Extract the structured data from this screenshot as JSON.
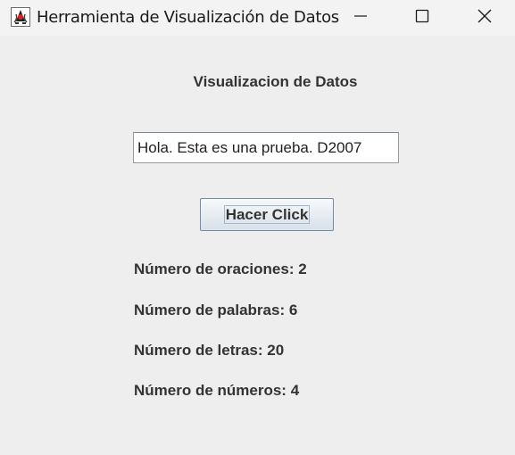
{
  "window": {
    "title": "Herramienta de Visualización de Datos",
    "icon": "java-duke-icon"
  },
  "controls": {
    "minimize": "minimize-icon",
    "maximize": "maximize-icon",
    "close": "close-icon"
  },
  "main": {
    "heading": "Visualizacion de Datos",
    "input_value": "Hola. Esta es una prueba. D2007",
    "button_label": "Hacer Click",
    "stats": [
      "Número de oraciones: 2",
      "Número de palabras: 6",
      "Número de letras: 20",
      "Número de números: 4"
    ]
  },
  "colors": {
    "background": "#eeeeee",
    "text": "#333333",
    "button_border": "#7a8aa0"
  }
}
